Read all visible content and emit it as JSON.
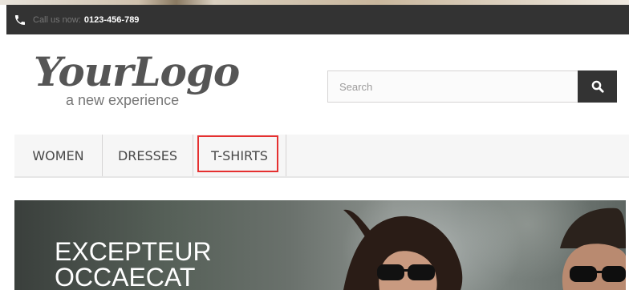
{
  "header": {
    "call_label": "Call us now:",
    "phone_number": "0123-456-789",
    "icon": "phone-icon"
  },
  "logo": {
    "title": "YourLogo",
    "tagline": "a new experience"
  },
  "search": {
    "placeholder": "Search",
    "value": "",
    "button_icon": "search-icon"
  },
  "menu": {
    "items": [
      {
        "label": "WOMEN"
      },
      {
        "label": "DRESSES"
      },
      {
        "label": "T-SHIRTS",
        "highlighted": true
      }
    ]
  },
  "slider": {
    "heading_line1": "EXCEPTEUR",
    "heading_line2": "OCCAECAT"
  },
  "colors": {
    "top_bar": "#333333",
    "search_button": "#333333",
    "highlight_border": "#e53030",
    "menu_background": "#f6f6f6"
  }
}
